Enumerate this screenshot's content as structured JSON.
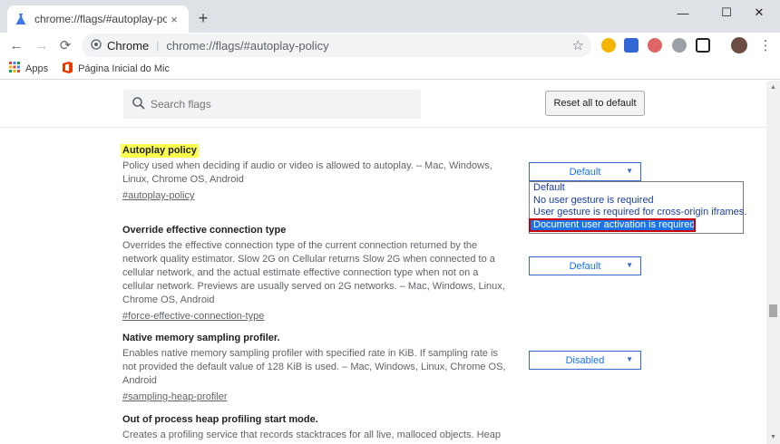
{
  "tab": {
    "title": "chrome://flags/#autoplay-policy",
    "close": "×"
  },
  "new_tab": "+",
  "window": {
    "minimize": "—",
    "maximize": "☐",
    "close": "✕"
  },
  "toolbar": {
    "back": "←",
    "forward": "→",
    "reload": "⟳",
    "omnibox_site": "Chrome",
    "omnibox_url": "chrome://flags/#autoplay-policy",
    "star": "☆",
    "menu": "⋮"
  },
  "bookmarks": [
    {
      "label": "Apps",
      "icon": "apps-grid-icon"
    },
    {
      "label": "Página Inicial do Mic",
      "icon": "office-icon"
    }
  ],
  "search": {
    "placeholder": "Search flags"
  },
  "reset_label": "Reset all to default",
  "flags": [
    {
      "title": "Autoplay policy",
      "desc": "Policy used when deciding if audio or video is allowed to autoplay. – Mac, Windows, Linux, Chrome OS, Android",
      "link": "#autoplay-policy",
      "value": "Default"
    },
    {
      "title": "Override effective connection type",
      "desc": "Overrides the effective connection type of the current connection returned by the network quality estimator. Slow 2G on Cellular returns Slow 2G when connected to a cellular network, and the actual estimate effective connection type when not on a cellular network. Previews are usually served on 2G networks. – Mac, Windows, Linux, Chrome OS, Android",
      "link": "#force-effective-connection-type",
      "value": "Default"
    },
    {
      "title": "Native memory sampling profiler.",
      "desc": "Enables native memory sampling profiler with specified rate in KiB. If sampling rate is not provided the default value of 128 KiB is used. – Mac, Windows, Linux, Chrome OS, Android",
      "link": "#sampling-heap-profiler",
      "value": "Disabled"
    },
    {
      "title": "Out of process heap profiling start mode.",
      "desc": "Creates a profiling service that records stacktraces for all live, malloced objects. Heap"
    }
  ],
  "dropdown_options": [
    "Default",
    "No user gesture is required",
    "User gesture is required for cross-origin iframes.",
    "Document user activation is required."
  ],
  "dropdown_selected": "Document user activation is required.",
  "colors": {
    "highlight": "#ffff4d",
    "select_border": "#3367d6",
    "selected_option": "#1a73e8",
    "annotation_box": "#cc0000"
  }
}
